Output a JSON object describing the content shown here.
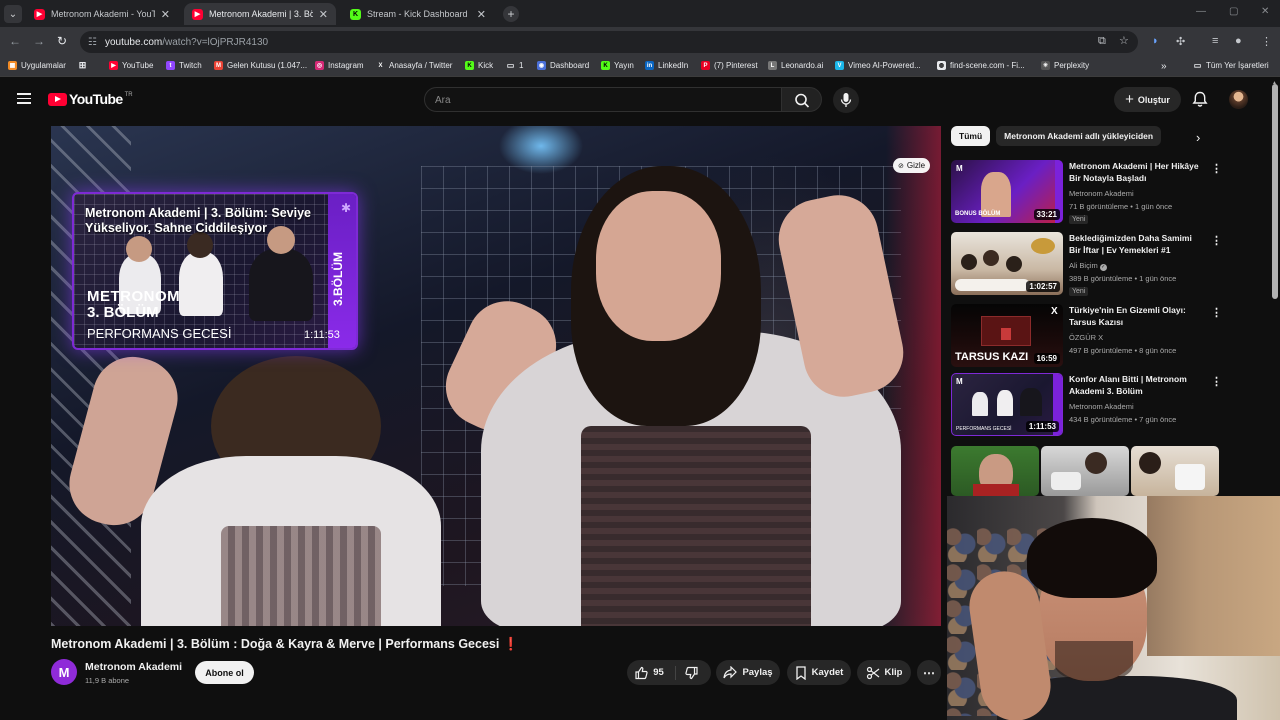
{
  "browser": {
    "tabs": [
      {
        "title": "Metronom Akademi - YouTube",
        "active": false,
        "icon": "youtube-icon"
      },
      {
        "title": "Metronom Akademi | 3. Bölüm",
        "active": true,
        "icon": "youtube-icon"
      },
      {
        "title": "Stream - Kick Dashboard",
        "active": false,
        "icon": "kick-icon"
      }
    ],
    "url_host": "youtube.com",
    "url_path": "/watch?v=lOjPRJR4130",
    "bookmarks": [
      {
        "label": "Uygulamalar",
        "icon": "apps-grid-icon"
      },
      {
        "label": "YouTube",
        "icon": "youtube-icon"
      },
      {
        "label": "Twitch",
        "icon": "twitch-icon"
      },
      {
        "label": "Gelen Kutusu (1.047...",
        "icon": "gmail-icon"
      },
      {
        "label": "Instagram",
        "icon": "instagram-icon"
      },
      {
        "label": "Anasayfa / Twitter",
        "icon": "x-icon"
      },
      {
        "label": "Kick",
        "icon": "kick-icon"
      },
      {
        "label": "1",
        "icon": "folder-icon"
      },
      {
        "label": "Dashboard",
        "icon": "dashboard-icon"
      },
      {
        "label": "Yayın",
        "icon": "kick-icon"
      },
      {
        "label": "LinkedIn",
        "icon": "linkedin-icon"
      },
      {
        "label": "(7) Pinterest",
        "icon": "pinterest-icon"
      },
      {
        "label": "Leonardo.ai",
        "icon": "leonardo-icon"
      },
      {
        "label": "Vimeo AI-Powered...",
        "icon": "vimeo-icon"
      },
      {
        "label": "find-scene.com - Fi...",
        "icon": "globe-icon"
      },
      {
        "label": "Perplexity",
        "icon": "perplexity-icon"
      }
    ],
    "all_bookmarks": "Tüm Yer İşaretleri"
  },
  "youtube": {
    "logo_text": "YouTube",
    "country_code": "TR",
    "search_placeholder": "Ara",
    "create_label": "Oluştur"
  },
  "player": {
    "hide_label": "Gizle",
    "card": {
      "title": "Metronom Akademi | 3. Bölüm: Seviye Yükseliyor, Sahne Ciddileşiyor",
      "brand": "METRONOM",
      "episode": "3. BÖLÜM",
      "subtitle": "PERFORMANS GECESİ",
      "side_label": "3.BÖLÜM",
      "duration": "1:11:53"
    }
  },
  "video": {
    "title": "Metronom Akademi | 3. Bölüm : Doğa & Kayra & Merve | Performans Gecesi",
    "title_suffix": "❗",
    "channel": "Metronom Akademi",
    "subscribers": "11,9 B abone",
    "subscribe_label": "Abone ol",
    "likes": "95",
    "share_label": "Paylaş",
    "save_label": "Kaydet",
    "clip_label": "Klip"
  },
  "sidebar": {
    "chips": [
      "Tümü",
      "Metronom Akademi adlı yükleyiciden"
    ],
    "recommendations": [
      {
        "title": "Metronom Akademi | Her Hikâye Bir Notayla Başladı",
        "channel": "Metronom Akademi",
        "meta": "71 B görüntüleme • 1 gün önce",
        "badge": "Yeni",
        "duration": "33:21",
        "thumb_text": "BONUS BÖLÜM",
        "verified": false
      },
      {
        "title": "Beklediğimizden Daha Samimi Bir İftar | Ev Yemekleri #1",
        "channel": "Ali Biçim",
        "meta": "389 B görüntüleme • 1 gün önce",
        "badge": "Yeni",
        "duration": "1:02:57",
        "thumb_text": "",
        "verified": true
      },
      {
        "title": "Türkiye'nin En Gizemli Olayı: Tarsus Kazısı",
        "channel": "ÖZGÜR X",
        "meta": "497 B görüntüleme • 8 gün önce",
        "badge": "",
        "duration": "16:59",
        "thumb_text": "TARSUS KAZI",
        "verified": false
      },
      {
        "title": "Konfor Alanı Bitti | Metronom Akademi 3. Bölüm",
        "channel": "Metronom Akademi",
        "meta": "434 B görüntüleme • 7 gün önce",
        "badge": "",
        "duration": "1:11:53",
        "thumb_text": "PERFORMANS GECESİ",
        "verified": false
      }
    ]
  }
}
